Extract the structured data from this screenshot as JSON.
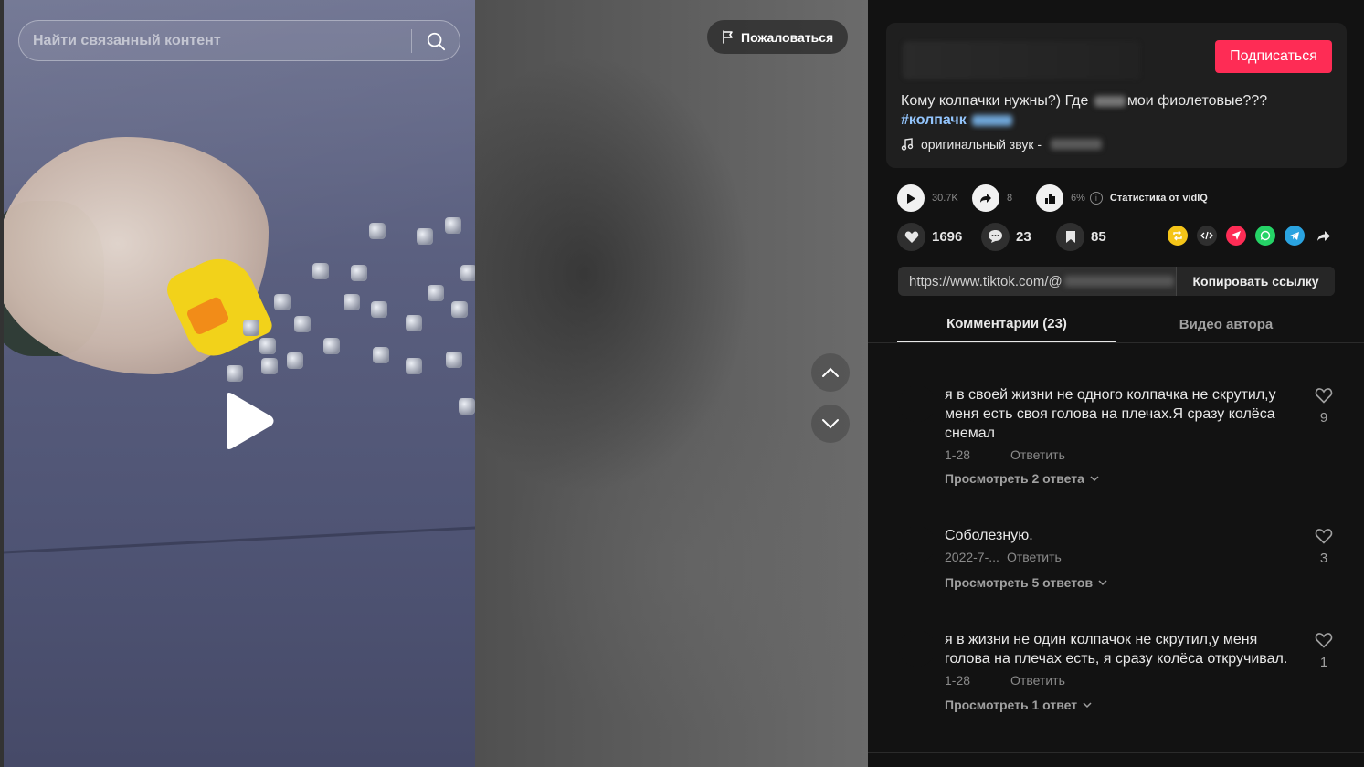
{
  "video": {
    "search_placeholder": "Найти связанный контент",
    "report_label": "Пожаловаться"
  },
  "post": {
    "subscribe_label": "Подписаться",
    "description_part1": "Кому колпачки нужны?) Где",
    "description_part2": "мои фиолетовые???",
    "hashtag": "#колпачк",
    "sound_text": "оригинальный звук -"
  },
  "vidiq": {
    "views": "30.7K",
    "shares": "8",
    "engagement": "6%",
    "label": "Статистика от vidIQ"
  },
  "stats": {
    "likes": "1696",
    "comments": "23",
    "saves": "85"
  },
  "link": {
    "url": "https://www.tiktok.com/@",
    "copy_label": "Копировать ссылку"
  },
  "tabs": {
    "comments": "Комментарии (23)",
    "author_videos": "Видео автора"
  },
  "comments": [
    {
      "text": "я в своей жизни не одного колпачка не скрутил,у меня есть своя голова на плечах.Я сразу колёса снемал",
      "date": "1-28",
      "reply": "Ответить",
      "replies": "Просмотреть 2 ответа",
      "likes": "9"
    },
    {
      "text": "Соболезную.",
      "date": "2022-7-...",
      "reply": "Ответить",
      "replies": "Просмотреть 5 ответов",
      "likes": "3"
    },
    {
      "text": "я в жизни не один колпачок не скрутил,у меня голова на плечах есть, я сразу колёса откручивал.",
      "date": "1-28",
      "reply": "Ответить",
      "replies": "Просмотреть 1 ответ",
      "likes": "1"
    }
  ],
  "colors": {
    "accent": "#fe2c55",
    "hashtag": "#93c5fd",
    "background": "#121212"
  }
}
